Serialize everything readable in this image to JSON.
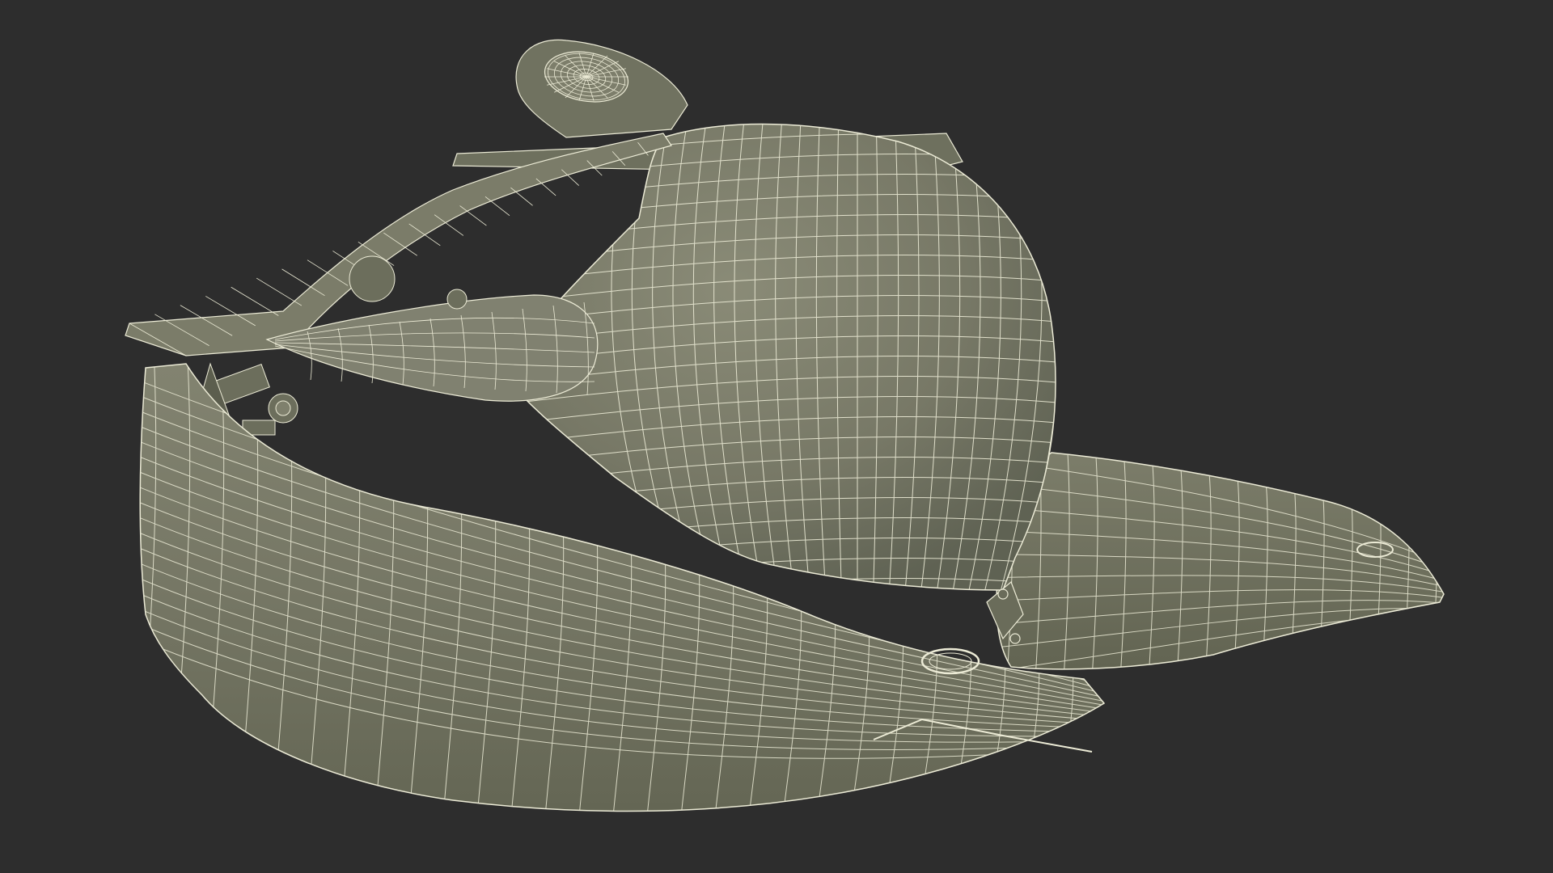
{
  "scene": {
    "subject": "submersible-wireframe-render",
    "background_color": "#2d2d2d",
    "mesh_fill_color": "#777866",
    "mesh_shadow_color": "#5f6253",
    "mesh_highlight_color": "#8a8b77",
    "wire_color": "#ecebd6"
  }
}
